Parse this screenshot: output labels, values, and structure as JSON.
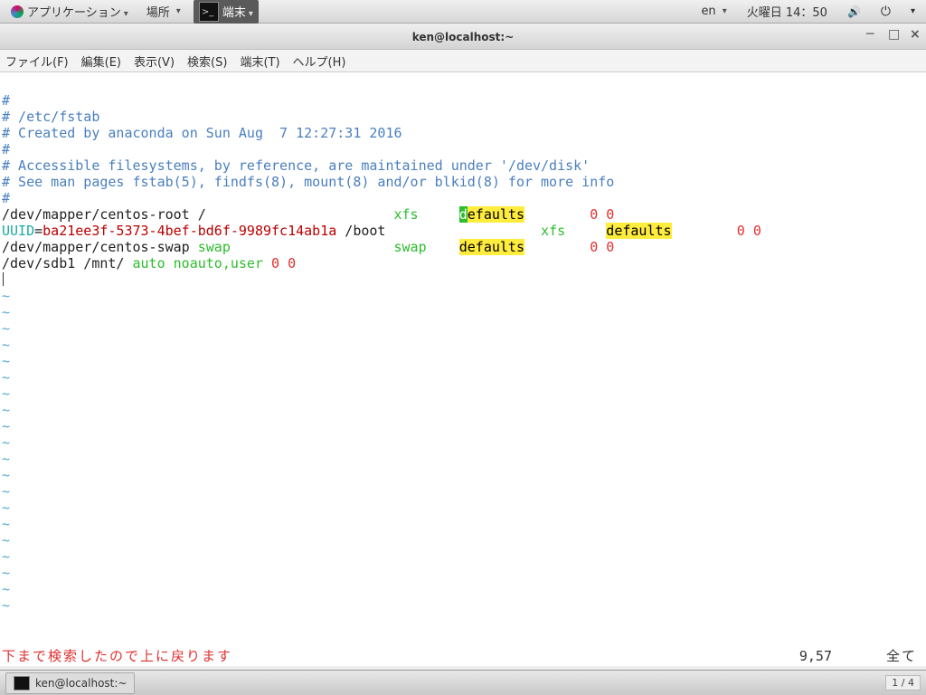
{
  "topbar": {
    "applications": "アプリケーション",
    "places": "場所",
    "terminal": "端末",
    "lang": "en",
    "date": "火曜日 14：50"
  },
  "window": {
    "title": "ken@localhost:~"
  },
  "menubar": {
    "file": "ファイル(F)",
    "edit": "編集(E)",
    "view": "表示(V)",
    "search": "検索(S)",
    "terminal": "端末(T)",
    "help": "ヘルプ(H)"
  },
  "file": {
    "c1": "#",
    "c2": "# /etc/fstab",
    "c3": "# Created by anaconda on Sun Aug  7 12:27:31 2016",
    "c4": "#",
    "c5": "# Accessible filesystems, by reference, are maintained under '/dev/disk'",
    "c6": "# See man pages fstab(5), findfs(8), mount(8) and/or blkid(8) for more info",
    "c7": "#",
    "l1_dev": "/dev/mapper/centos-root",
    "l1_mnt": " /                       ",
    "l1_fs": "xfs",
    "l1_sp": "     ",
    "l1_d1": "d",
    "l1_opt": "efaults",
    "l1_num": "0 0",
    "l2_uuid": "UUID",
    "l2_eq": "=",
    "l2_val": "ba21ee3f-5373-4bef-bd6f-9989fc14ab1a",
    "l2_mnt": " /boot                   ",
    "l2_fs": "xfs",
    "l2_opt": "defaults",
    "l2_num": "0 0",
    "l3_dev": "/dev/mapper/centos-swap",
    "l3_mnt": " swap                    ",
    "l3_fs": "swap",
    "l3_opt": "defaults",
    "l3_num": "0 0",
    "l4_dev": "/dev/sdb1 /mnt/",
    "l4_auto": " auto ",
    "l4_opt": "noauto",
    "l4_user": ",user",
    "l4_num": " 0 0",
    "swap": "swap",
    "tilde": "~"
  },
  "status": {
    "msg": "下まで検索したので上に戻ります",
    "pos": "9,57",
    "all": "全て"
  },
  "taskbar": {
    "label": "ken@localhost:~",
    "ws": "1 / 4"
  }
}
